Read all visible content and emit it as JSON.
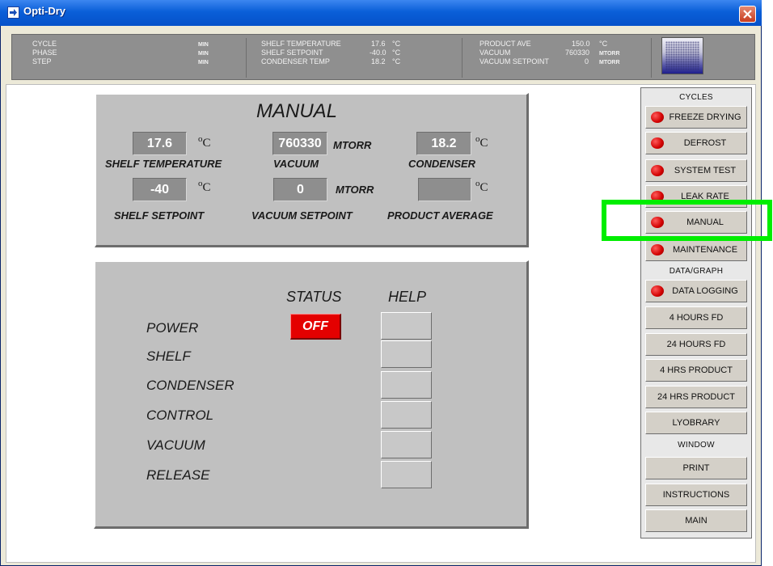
{
  "window": {
    "title": "Opti-Dry"
  },
  "status_header": {
    "col1": {
      "labels": [
        "CYCLE",
        "PHASE",
        "STEP"
      ],
      "units": [
        "MIN",
        "MIN",
        "MIN"
      ]
    },
    "col2": {
      "labels": [
        "SHELF TEMPERATURE",
        "SHELF SETPOINT",
        "CONDENSER TEMP"
      ],
      "values": [
        "17.6",
        "-40.0",
        "18.2"
      ],
      "units": [
        "°C",
        "°C",
        "°C"
      ]
    },
    "col3": {
      "labels": [
        "PRODUCT AVE",
        "VACUUM",
        "VACUUM SETPOINT"
      ],
      "values": [
        "150.0",
        "760330",
        "0"
      ],
      "units": [
        "°C",
        "MTORR",
        "MTORR"
      ]
    }
  },
  "manual_panel": {
    "title": "MANUAL",
    "shelf_temperature": {
      "value": "17.6",
      "unit": "C",
      "label": "SHELF TEMPERATURE"
    },
    "vacuum": {
      "value": "760330",
      "unit": "MTORR",
      "label": "VACUUM"
    },
    "condenser": {
      "value": "18.2",
      "unit": "C",
      "label": "CONDENSER"
    },
    "shelf_setpoint": {
      "value": "-40",
      "unit": "C",
      "label": "SHELF SETPOINT"
    },
    "vacuum_setpoint": {
      "value": "0",
      "unit": "MTORR",
      "label": "VACUUM SETPOINT"
    },
    "product_average": {
      "value": "",
      "unit": "C",
      "label": "PRODUCT AVERAGE"
    }
  },
  "status_panel": {
    "status_header": "STATUS",
    "help_header": "HELP",
    "rows": [
      "POWER",
      "SHELF",
      "CONDENSER",
      "CONTROL",
      "VACUUM",
      "RELEASE"
    ],
    "power_status": "OFF"
  },
  "sidebar": {
    "cycles_header": "CYCLES",
    "cycles": [
      "FREEZE DRYING",
      "DEFROST",
      "SYSTEM TEST",
      "LEAK RATE",
      "MANUAL",
      "MAINTENANCE"
    ],
    "data_header": "DATA/GRAPH",
    "data": [
      "DATA LOGGING",
      "4 HOURS FD",
      "24 HOURS FD",
      "4 HRS PRODUCT",
      "24 HRS PRODUCT",
      "LYOBRARY"
    ],
    "window_header": "WINDOW",
    "window": [
      "PRINT",
      "INSTRUCTIONS",
      "MAIN"
    ]
  },
  "colors": {
    "titlebar": "#0a5fd8",
    "panel": "#c0c0c0",
    "status_off": "#e40000",
    "indicator": "#d10000",
    "highlight": "#00ee00"
  }
}
